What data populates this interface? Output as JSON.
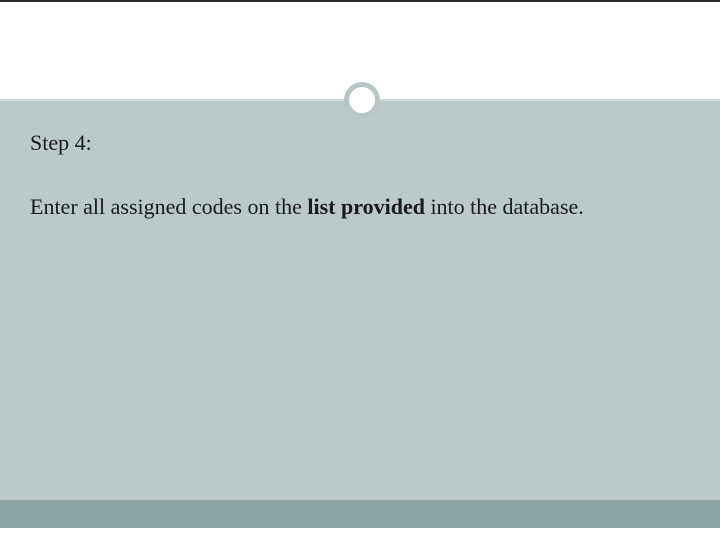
{
  "slide": {
    "step_label": "Step 4:",
    "body_pre": "Enter all assigned codes on the ",
    "body_bold": "list provided",
    "body_post": " into the database."
  }
}
